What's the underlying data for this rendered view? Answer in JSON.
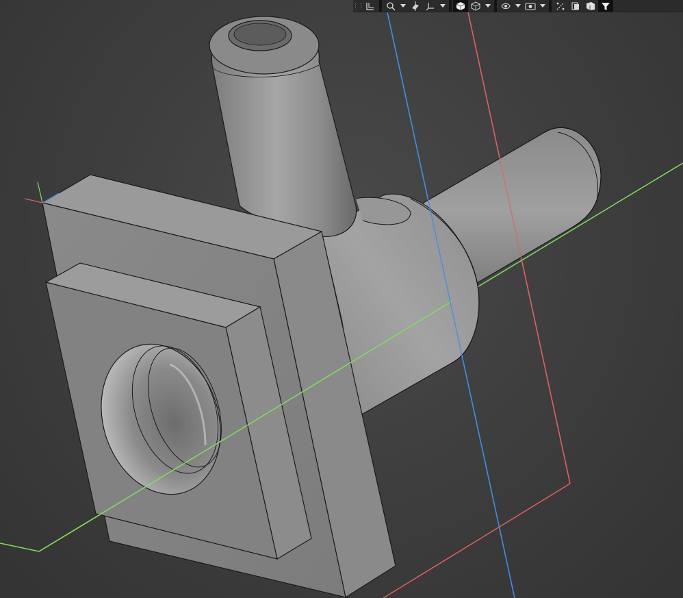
{
  "viewport": {
    "background_top": "#4a4a4a",
    "background_bottom": "#333333"
  },
  "axes": {
    "x_color": "#e06060",
    "y_color": "#7ee05a",
    "z_color": "#3d8ee6"
  },
  "model": {
    "body_color": "#8f8f8f",
    "edge_color": "#1a1a1a"
  },
  "toolbar": {
    "items": [
      {
        "name": "grip-handle",
        "icon": "grip-icon"
      },
      {
        "name": "sketch-plane-button",
        "icon": "sketch-plane-icon"
      },
      {
        "name": "zoom-button",
        "icon": "zoom-icon"
      },
      {
        "name": "section-view-button",
        "icon": "section-view-icon"
      },
      {
        "name": "triad-button",
        "icon": "triad-icon"
      },
      {
        "name": "shaded-view-button",
        "icon": "shaded-cube-icon"
      },
      {
        "name": "wireframe-view-button",
        "icon": "wireframe-cube-icon"
      },
      {
        "name": "hide-show-button",
        "icon": "eye-icon"
      },
      {
        "name": "render-button",
        "icon": "camera-icon"
      },
      {
        "name": "measure-button",
        "icon": "measure-icon"
      },
      {
        "name": "appearance-button",
        "icon": "appearance-icon"
      },
      {
        "name": "sheets-button",
        "icon": "sheets-icon"
      },
      {
        "name": "filter-button",
        "icon": "filter-icon"
      }
    ],
    "background": "#2b2b2b"
  }
}
